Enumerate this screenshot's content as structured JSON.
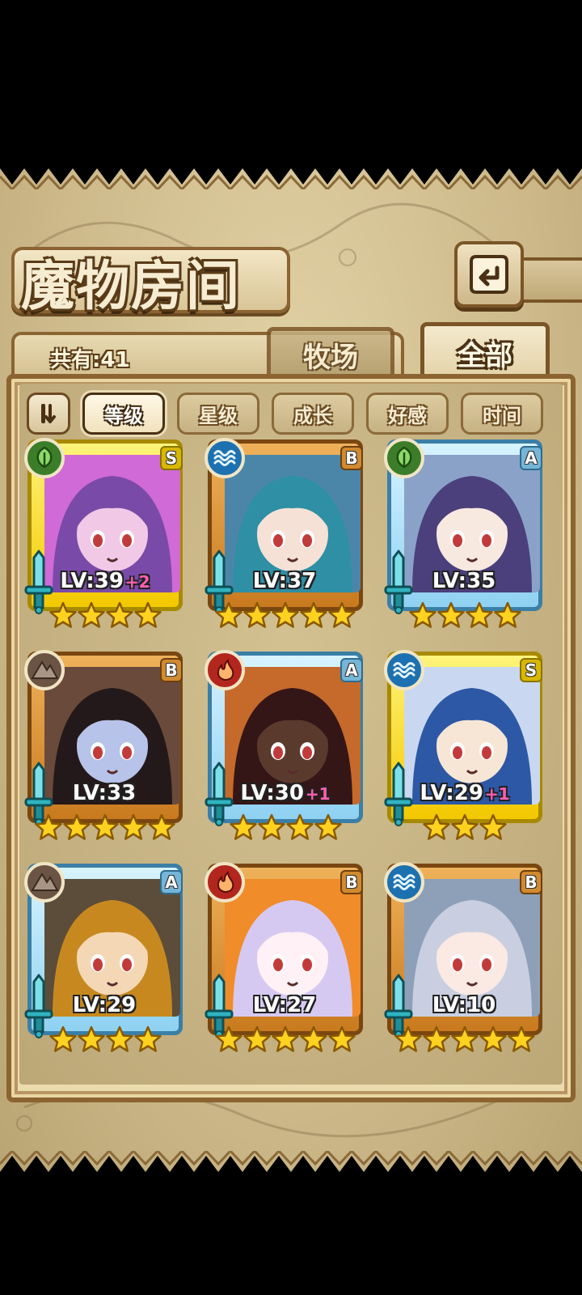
{
  "header": {
    "title": "魔物房间"
  },
  "count": {
    "label": "共有:41"
  },
  "tabs": [
    {
      "label": "牧场",
      "active": false
    },
    {
      "label": "全部",
      "active": true
    }
  ],
  "sort": {
    "options": [
      "等级",
      "星级",
      "成长",
      "好感",
      "时间"
    ],
    "selected": "等级"
  },
  "colors": {
    "nature": "#3c7d2a",
    "water": "#1d71b0",
    "earth": "#6b5444",
    "fire": "#b3261e"
  },
  "monsters": [
    {
      "element": "nature-icon",
      "rank": "S",
      "frame": "gold",
      "level": "LV:39",
      "plus": "+2",
      "stars": 4
    },
    {
      "element": "water-icon",
      "rank": "B",
      "frame": "orange",
      "level": "LV:37",
      "plus": "",
      "stars": 5
    },
    {
      "element": "nature-icon",
      "rank": "A",
      "frame": "blue",
      "level": "LV:35",
      "plus": "",
      "stars": 4
    },
    {
      "element": "earth-icon",
      "rank": "B",
      "frame": "orange",
      "level": "LV:33",
      "plus": "",
      "stars": 5
    },
    {
      "element": "fire-icon",
      "rank": "A",
      "frame": "blue",
      "level": "LV:30",
      "plus": "+1",
      "stars": 4
    },
    {
      "element": "water-icon",
      "rank": "S",
      "frame": "gold",
      "level": "LV:29",
      "plus": "+1",
      "stars": 3
    },
    {
      "element": "earth-icon",
      "rank": "A",
      "frame": "blue",
      "level": "LV:29",
      "plus": "",
      "stars": 4
    },
    {
      "element": "fire-icon",
      "rank": "B",
      "frame": "orange",
      "level": "LV:27",
      "plus": "",
      "stars": 5
    },
    {
      "element": "water-icon",
      "rank": "B",
      "frame": "orange",
      "level": "LV:10",
      "plus": "",
      "stars": 5
    }
  ]
}
